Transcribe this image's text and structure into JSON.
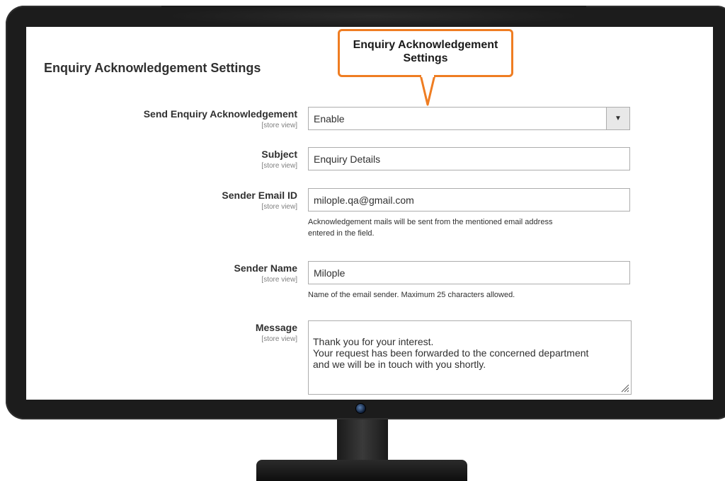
{
  "callout": {
    "line1": "Enquiry Acknowledgement",
    "line2": "Settings"
  },
  "section_title": "Enquiry Acknowledgement Settings",
  "fields": {
    "send_ack": {
      "label": "Send Enquiry Acknowledgement",
      "scope": "[store view]",
      "value": "Enable"
    },
    "subject": {
      "label": "Subject",
      "scope": "[store view]",
      "value": "Enquiry Details"
    },
    "sender_email": {
      "label": "Sender Email ID",
      "scope": "[store view]",
      "value": "milople.qa@gmail.com",
      "note_line1": "Acknowledgement mails will be sent from the mentioned email address",
      "note_line2": "entered in the field."
    },
    "sender_name": {
      "label": "Sender Name",
      "scope": "[store view]",
      "value": "Milople",
      "note": "Name of the email sender. Maximum 25 characters allowed."
    },
    "message": {
      "label": "Message",
      "scope": "[store view]",
      "value": "Thank you for your interest.\nYour request has been forwarded to the concerned department\nand we will be in touch with you shortly."
    }
  },
  "colors": {
    "callout_border": "#ef7d22",
    "monitor_frame": "#1c1c1c",
    "input_border": "#adadad"
  }
}
